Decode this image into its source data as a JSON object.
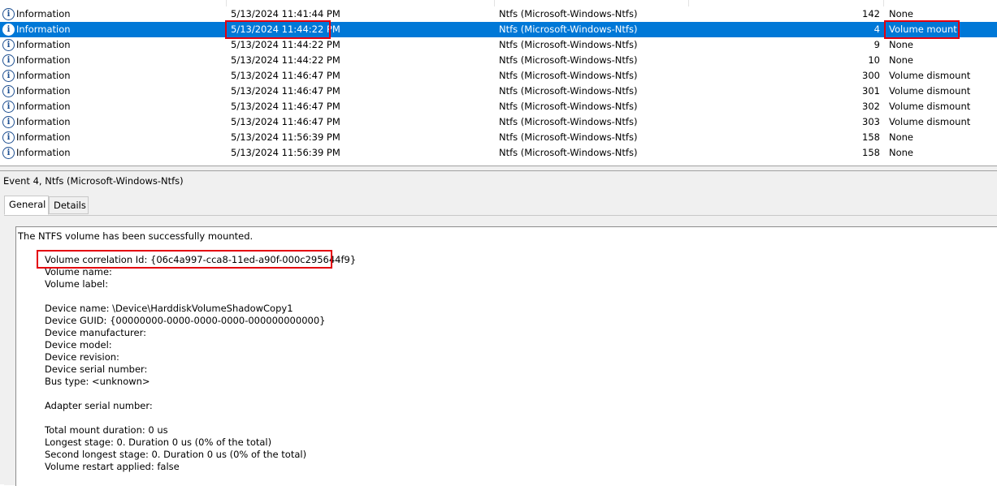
{
  "events": [
    {
      "level": "Information",
      "date": "5/13/2024 11:41:44 PM",
      "source": "Ntfs (Microsoft-Windows-Ntfs)",
      "event_id": "142",
      "task": "None",
      "selected": false
    },
    {
      "level": "Information",
      "date": "5/13/2024 11:44:22 PM",
      "source": "Ntfs (Microsoft-Windows-Ntfs)",
      "event_id": "4",
      "task": "Volume mount",
      "selected": true
    },
    {
      "level": "Information",
      "date": "5/13/2024 11:44:22 PM",
      "source": "Ntfs (Microsoft-Windows-Ntfs)",
      "event_id": "9",
      "task": "None",
      "selected": false
    },
    {
      "level": "Information",
      "date": "5/13/2024 11:44:22 PM",
      "source": "Ntfs (Microsoft-Windows-Ntfs)",
      "event_id": "10",
      "task": "None",
      "selected": false
    },
    {
      "level": "Information",
      "date": "5/13/2024 11:46:47 PM",
      "source": "Ntfs (Microsoft-Windows-Ntfs)",
      "event_id": "300",
      "task": "Volume dismount",
      "selected": false
    },
    {
      "level": "Information",
      "date": "5/13/2024 11:46:47 PM",
      "source": "Ntfs (Microsoft-Windows-Ntfs)",
      "event_id": "301",
      "task": "Volume dismount",
      "selected": false
    },
    {
      "level": "Information",
      "date": "5/13/2024 11:46:47 PM",
      "source": "Ntfs (Microsoft-Windows-Ntfs)",
      "event_id": "302",
      "task": "Volume dismount",
      "selected": false
    },
    {
      "level": "Information",
      "date": "5/13/2024 11:46:47 PM",
      "source": "Ntfs (Microsoft-Windows-Ntfs)",
      "event_id": "303",
      "task": "Volume dismount",
      "selected": false
    },
    {
      "level": "Information",
      "date": "5/13/2024 11:56:39 PM",
      "source": "Ntfs (Microsoft-Windows-Ntfs)",
      "event_id": "158",
      "task": "None",
      "selected": false
    },
    {
      "level": "Information",
      "date": "5/13/2024 11:56:39 PM",
      "source": "Ntfs (Microsoft-Windows-Ntfs)",
      "event_id": "158",
      "task": "None",
      "selected": false
    }
  ],
  "level_icon": "information-icon",
  "detail": {
    "title": "Event 4, Ntfs (Microsoft-Windows-Ntfs)",
    "tabs": {
      "general": "General",
      "details": "Details"
    },
    "message": {
      "heading": "The NTFS volume has been successfully mounted.",
      "correlation_id": "Volume correlation Id: {06c4a997-cca8-11ed-a90f-000c295644f9}",
      "volume_name": "Volume name:",
      "volume_label": "Volume label:",
      "device_name": "Device name: \\Device\\HarddiskVolumeShadowCopy1",
      "device_guid": "Device GUID: {00000000-0000-0000-0000-000000000000}",
      "device_manufacturer": "Device manufacturer:",
      "device_model": "Device model:",
      "device_revision": "Device revision:",
      "device_serial": "Device serial number:",
      "bus_type": "Bus type: <unknown>",
      "adapter_serial": "Adapter serial number:",
      "total_mount": "Total mount duration: 0 us",
      "longest_stage": "Longest stage: 0. Duration 0 us (0% of the total)",
      "second_longest": "Second longest stage: 0. Duration 0 us (0% of the total)",
      "restart_applied": "Volume restart applied: false"
    }
  },
  "colors": {
    "selection": "#0078d7",
    "highlight_box": "#e4000f",
    "panel_bg": "#f0f0f0"
  }
}
